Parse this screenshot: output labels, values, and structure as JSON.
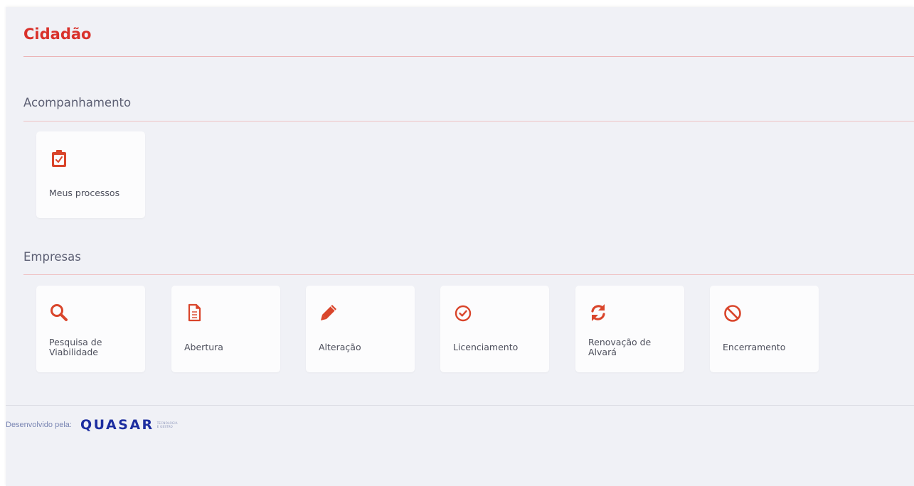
{
  "page": {
    "title": "Cidadão"
  },
  "sections": {
    "acompanhamento": {
      "heading": "Acompanhamento",
      "cards": [
        {
          "label": "Meus processos",
          "icon": "clipboard-check-icon"
        }
      ]
    },
    "empresas": {
      "heading": "Empresas",
      "cards": [
        {
          "label": "Pesquisa de Viabilidade",
          "icon": "search-icon"
        },
        {
          "label": "Abertura",
          "icon": "document-icon"
        },
        {
          "label": "Alteração",
          "icon": "pencil-icon"
        },
        {
          "label": "Licenciamento",
          "icon": "check-circle-icon"
        },
        {
          "label": "Renovação de Alvará",
          "icon": "refresh-icon"
        },
        {
          "label": "Encerramento",
          "icon": "ban-icon"
        }
      ]
    }
  },
  "footer": {
    "text": "Desenvolvido pela:",
    "brand_name": "QUASAR",
    "brand_tag_line1": "TECNOLOGIA",
    "brand_tag_line2": "E GESTÃO"
  },
  "colors": {
    "accent": "#d9312b",
    "icon": "#d9452b",
    "brand": "#1d2ea0",
    "background": "#f0f1f6",
    "card": "#fcfcfd"
  }
}
